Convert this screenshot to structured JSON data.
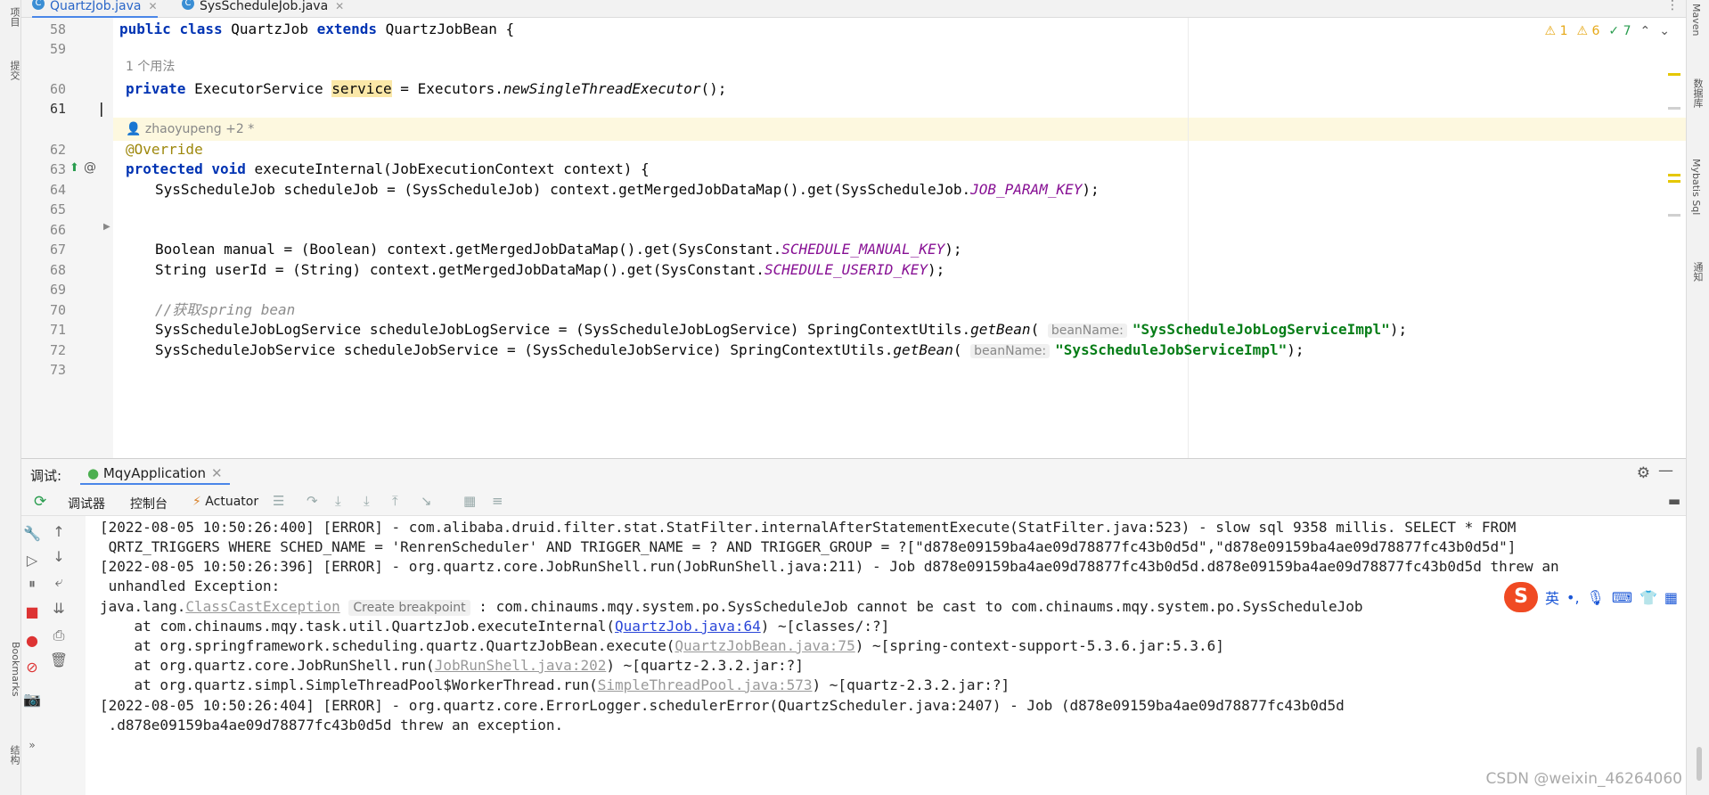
{
  "tabs": [
    {
      "label": "QuartzJob.java",
      "active": true
    },
    {
      "label": "SysScheduleJob.java",
      "active": false
    }
  ],
  "left_strip": {
    "items": [
      "项目",
      "提交",
      "Bookmarks",
      "结构"
    ]
  },
  "right_strip": {
    "items": [
      "Maven",
      "数据库",
      "Mybatis Sql",
      "通知"
    ]
  },
  "indicators": {
    "errors": "1",
    "warnings": "6",
    "ok": "7"
  },
  "editor": {
    "lines": [
      {
        "num": "58",
        "code": "public class QuartzJob extends QuartzJobBean {"
      },
      {
        "num": "59",
        "code": ""
      },
      {
        "meta": "1 个用法"
      },
      {
        "num": "60",
        "code": "private ExecutorService service = Executors.newSingleThreadExecutor();"
      },
      {
        "num": "61",
        "code": ""
      },
      {
        "meta": "zhaoyupeng +2 *"
      },
      {
        "num": "62",
        "code": "@Override"
      },
      {
        "num": "63",
        "code": "protected void executeInternal(JobExecutionContext context) {"
      },
      {
        "num": "64",
        "code": "SysScheduleJob scheduleJob = (SysScheduleJob) context.getMergedJobDataMap().get(SysScheduleJob.JOB_PARAM_KEY);"
      },
      {
        "num": "65",
        "code": ""
      },
      {
        "num": "66",
        "code": ""
      },
      {
        "num": "67",
        "code": "Boolean manual = (Boolean) context.getMergedJobDataMap().get(SysConstant.SCHEDULE_MANUAL_KEY);"
      },
      {
        "num": "68",
        "code": "String userId = (String) context.getMergedJobDataMap().get(SysConstant.SCHEDULE_USERID_KEY);"
      },
      {
        "num": "69",
        "code": ""
      },
      {
        "num": "70",
        "code": "//获取spring bean"
      },
      {
        "num": "71",
        "code": "SysScheduleJobLogService scheduleJobLogService = (SysScheduleJobLogService) SpringContextUtils.getBean( beanName: \"SysScheduleJobLogServiceImpl\");"
      },
      {
        "num": "72",
        "code": "SysScheduleJobService scheduleJobService = (SysScheduleJobService) SpringContextUtils.getBean( beanName: \"SysScheduleJobServiceImpl\");"
      },
      {
        "num": "73",
        "code": ""
      }
    ],
    "tokens": {
      "kw_public": "public",
      "kw_class": "class",
      "cls_QuartzJob": "QuartzJob",
      "kw_extends": "extends",
      "cls_QuartzJobBean": "QuartzJobBean {",
      "kw_private": "private",
      "t_ExecutorService": "ExecutorService",
      "v_service": "service",
      "eq_exec": "= Executors.",
      "m_newSingle": "newSingleThreadExecutor",
      "paren_end": "();",
      "ann_override": "@Override",
      "kw_protected": "protected",
      "kw_void": "void",
      "m_executeInternal": "executeInternal",
      "params63": "(JobExecutionContext context) {",
      "l64a": "SysScheduleJob scheduleJob = (SysScheduleJob) context.getMergedJobDataMap().get(SysScheduleJob.",
      "c_JOB_PARAM_KEY": "JOB_PARAM_KEY",
      "l64b": ");",
      "l67a": "Boolean manual = (Boolean) context.getMergedJobDataMap().get(SysConstant.",
      "c_MANUAL": "SCHEDULE_MANUAL_KEY",
      "l67b": ");",
      "l68a": "String userId = (String) context.getMergedJobDataMap().get(SysConstant.",
      "c_USERID": "SCHEDULE_USERID_KEY",
      "l68b": ");",
      "cmt70": "//获取spring bean",
      "l71a": "SysScheduleJobLogService scheduleJobLogService = (SysScheduleJobLogService) SpringContextUtils.",
      "m_getBean": "getBean",
      "open": "(",
      "hint_beanName": "beanName:",
      "s71": "\"SysScheduleJobLogServiceImpl\"",
      "close": ");",
      "l72a": "SysScheduleJobService scheduleJobService = (SysScheduleJobService) SpringContextUtils.",
      "s72": "\"SysScheduleJobServiceImpl\""
    }
  },
  "debug": {
    "title_label": "调试:",
    "app_name": "MqyApplication",
    "toolbar": {
      "debugger": "调试器",
      "console": "控制台",
      "actuator": "Actuator"
    },
    "console": {
      "l1": "[2022-08-05 10:50:26:400] [ERROR] - com.alibaba.druid.filter.stat.StatFilter.internalAfterStatementExecute(StatFilter.java:523) - slow sql 9358 millis. SELECT * FROM",
      "l2": " QRTZ_TRIGGERS WHERE SCHED_NAME = 'RenrenScheduler' AND TRIGGER_NAME = ? AND TRIGGER_GROUP = ?[\"d878e09159ba4ae09d78877fc43b0d5d\",\"d878e09159ba4ae09d78877fc43b0d5d\"]",
      "l3": "[2022-08-05 10:50:26:396] [ERROR] - org.quartz.core.JobRunShell.run(JobRunShell.java:211) - Job d878e09159ba4ae09d78877fc43b0d5d.d878e09159ba4ae09d78877fc43b0d5d threw an",
      "l4": " unhandled Exception:",
      "l5a": "java.lang.",
      "l5_exc": "ClassCastException",
      "l5_bp": "Create breakpoint",
      "l5b": " : com.chinaums.mqy.system.po.SysScheduleJob cannot be cast to com.chinaums.mqy.system.po.SysScheduleJob",
      "l6a": "    at com.chinaums.mqy.task.util.QuartzJob.executeInternal(",
      "l6_link": "QuartzJob.java:64",
      "l6b": ") ~[classes/:?]",
      "l7a": "    at org.springframework.scheduling.quartz.QuartzJobBean.execute(",
      "l7_link": "QuartzJobBean.java:75",
      "l7b": ") ~[spring-context-support-5.3.6.jar:5.3.6]",
      "l8a": "    at org.quartz.core.JobRunShell.run(",
      "l8_link": "JobRunShell.java:202",
      "l8b": ") ~[quartz-2.3.2.jar:?]",
      "l9a": "    at org.quartz.simpl.SimpleThreadPool$WorkerThread.run(",
      "l9_link": "SimpleThreadPool.java:573",
      "l9b": ") ~[quartz-2.3.2.jar:?]",
      "l10": "[2022-08-05 10:50:26:404] [ERROR] - org.quartz.core.ErrorLogger.schedulerError(QuartzScheduler.java:2407) - Job (d878e09159ba4ae09d78877fc43b0d5d",
      "l11": " .d878e09159ba4ae09d78877fc43b0d5d threw an exception."
    }
  },
  "ime": {
    "lang": "英"
  },
  "watermark": "CSDN @weixin_46264060"
}
